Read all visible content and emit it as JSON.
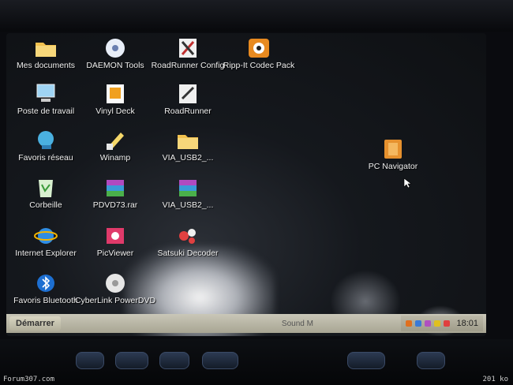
{
  "desktop": {
    "icons": [
      {
        "label": "Mes documents",
        "icon": "folder-icon"
      },
      {
        "label": "DAEMON Tools",
        "icon": "daemon-tools-icon"
      },
      {
        "label": "RoadRunner Config",
        "icon": "roadrunner-config-icon"
      },
      {
        "label": "Ripp-It Codec Pack",
        "icon": "codec-pack-icon"
      },
      {
        "label": "Poste de travail",
        "icon": "computer-icon"
      },
      {
        "label": "Vinyl Deck",
        "icon": "vinyl-deck-icon"
      },
      {
        "label": "RoadRunner",
        "icon": "roadrunner-icon"
      },
      {
        "label": "Favoris réseau",
        "icon": "network-icon"
      },
      {
        "label": "Winamp",
        "icon": "winamp-icon"
      },
      {
        "label": "VIA_USB2_...",
        "icon": "folder-icon"
      },
      {
        "label": "Corbeille",
        "icon": "recycle-bin-icon"
      },
      {
        "label": "PDVD73.rar",
        "icon": "rar-archive-icon"
      },
      {
        "label": "VIA_USB2_...",
        "icon": "rar-archive-icon"
      },
      {
        "label": "Internet Explorer",
        "icon": "internet-explorer-icon"
      },
      {
        "label": "PicViewer",
        "icon": "picviewer-icon"
      },
      {
        "label": "Satsuki Decoder",
        "icon": "satsuki-icon"
      },
      {
        "label": "Favoris Bluetooth",
        "icon": "bluetooth-icon"
      },
      {
        "label": "CyberLink PowerDVD",
        "icon": "powerdvd-icon"
      },
      {
        "label": "PC Navigator",
        "icon": "pc-navigator-icon"
      }
    ]
  },
  "taskbar": {
    "start_label": "Démarrer",
    "task_label": "Sound M",
    "clock": "18:01"
  },
  "watermark": {
    "left": "Forum307.com",
    "right": "201 ko"
  }
}
